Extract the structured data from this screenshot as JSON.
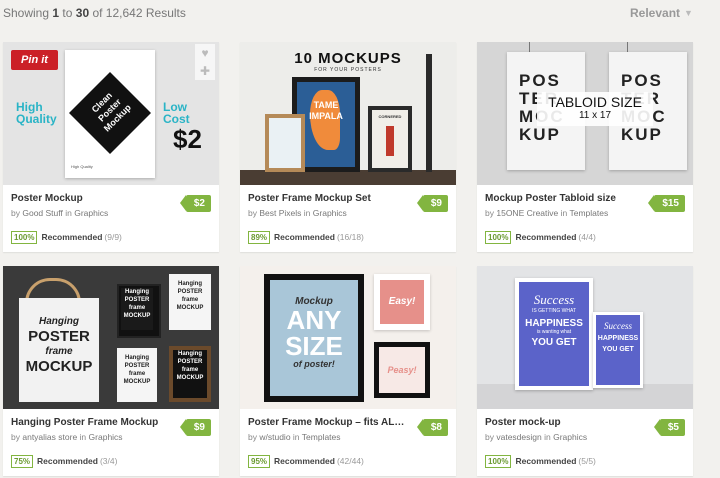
{
  "header": {
    "showing_prefix": "Showing",
    "range_start": "1",
    "range_sep": "to",
    "range_end": "30",
    "of_text": "of 12,642 Results",
    "sort_label": "Relevant"
  },
  "colors": {
    "price_badge": "#82b540",
    "pinit": "#cb2027",
    "page_bg": "#f2f1ee"
  },
  "cards": [
    {
      "title": "Poster Mockup",
      "author": "Good Stuff",
      "category": "Graphics",
      "price": "$2",
      "pct": "100%",
      "rec_label": "Recommended",
      "rec_count": "(9/9)",
      "art": {
        "pin": "Pin it",
        "left1": "High",
        "left2": "Quality",
        "right1": "Low",
        "right2": "Cost",
        "right3": "$2",
        "diamond": [
          "Clean",
          "Poster",
          "Mockup"
        ],
        "caption": "High Quality"
      }
    },
    {
      "title": "Poster Frame Mockup Set",
      "author": "Best Pixels",
      "category": "Graphics",
      "price": "$9",
      "pct": "89%",
      "rec_label": "Recommended",
      "rec_count": "(16/18)",
      "art": {
        "headline": "10 MOCKUPS",
        "sub": "FOR YOUR POSTERS",
        "poster_text1": "TAME",
        "poster_text2": "IMPALA",
        "poster_text3": "CORNERED"
      }
    },
    {
      "title": "Mockup Poster Tabloid size",
      "author": "15ONE Creative",
      "category": "Templates",
      "price": "$15",
      "pct": "100%",
      "rec_label": "Recommended",
      "rec_count": "(4/4)",
      "art": {
        "label": "TABLOID SIZE",
        "size": "11 x 17",
        "letters": [
          "POS",
          "TER",
          "MOC",
          "KUP"
        ]
      }
    },
    {
      "title": "Hanging Poster Frame Mockup",
      "author": "antyalias store",
      "category": "Graphics",
      "price": "$9",
      "pct": "75%",
      "rec_label": "Recommended",
      "rec_count": "(3/4)",
      "art": {
        "lines": [
          "Hanging",
          "POSTER",
          "frame",
          "MOCKUP"
        ]
      }
    },
    {
      "title": "Poster Frame Mockup – fits ALL ...",
      "author": "w/studio",
      "category": "Templates",
      "price": "$8",
      "pct": "95%",
      "rec_label": "Recommended",
      "rec_count": "(42/44)",
      "art": {
        "big1": "Mockup",
        "big2": "ANY",
        "big3": "SIZE",
        "big4": "of poster!",
        "easy": "Easy!",
        "peasy": "Peasy!"
      }
    },
    {
      "title": "Poster mock-up",
      "author": "vatesdesign",
      "category": "Graphics",
      "price": "$5",
      "pct": "100%",
      "rec_label": "Recommended",
      "rec_count": "(5/5)",
      "art": {
        "l1": "Success",
        "l2": "IS GETTING WHAT",
        "l3": "HAPPINESS",
        "l4": "is wanting what",
        "l5": "YOU GET"
      }
    }
  ],
  "by_word": "by",
  "in_word": "in"
}
